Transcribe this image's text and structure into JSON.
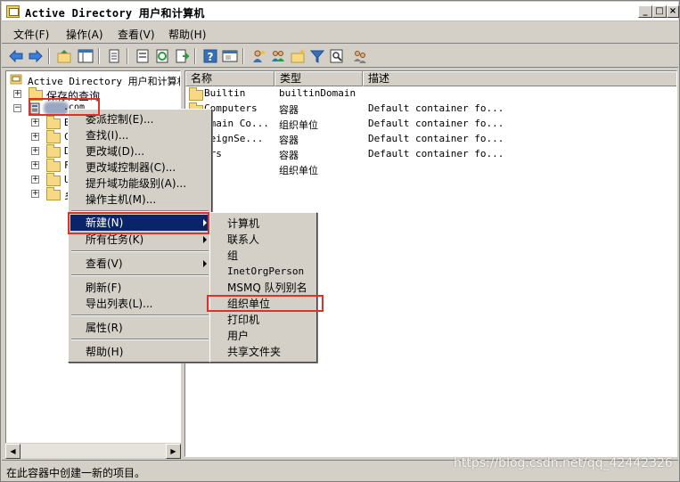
{
  "window": {
    "title": "Active Directory 用户和计算机"
  },
  "menubar": [
    {
      "label": "文件(F)"
    },
    {
      "label": "操作(A)"
    },
    {
      "label": "查看(V)"
    },
    {
      "label": "帮助(H)"
    }
  ],
  "tree": {
    "root": "Active Directory 用户和计算机",
    "saved_queries": "保存的查询",
    "domain_label": ".com",
    "children": [
      "B",
      "C",
      "D",
      "F",
      "U",
      "乡"
    ]
  },
  "list": {
    "columns": [
      "名称",
      "类型",
      "描述"
    ],
    "rows": [
      {
        "name": "Builtin",
        "type": "builtinDomain",
        "desc": ""
      },
      {
        "name": "Computers",
        "type": "容器",
        "desc": "Default container fo..."
      },
      {
        "name": "omain Co...",
        "type": "组织单位",
        "desc": "Default container fo..."
      },
      {
        "name": "reignSe...",
        "type": "容器",
        "desc": "Default container fo..."
      },
      {
        "name": "ers",
        "type": "容器",
        "desc": "Default container fo..."
      },
      {
        "name": "司",
        "type": "组织单位",
        "desc": ""
      }
    ]
  },
  "context_menu": {
    "items": [
      "委派控制(E)...",
      "查找(I)...",
      "更改域(D)...",
      "更改域控制器(C)...",
      "提升域功能级别(A)...",
      "操作主机(M)...",
      "新建(N)",
      "所有任务(K)",
      "查看(V)",
      "刷新(F)",
      "导出列表(L)...",
      "属性(R)",
      "帮助(H)"
    ]
  },
  "submenu": {
    "items": [
      "计算机",
      "联系人",
      "组",
      "InetOrgPerson",
      "MSMQ 队列别名",
      "组织单位",
      "打印机",
      "用户",
      "共享文件夹"
    ]
  },
  "statusbar": {
    "text": "在此容器中创建一新的项目。"
  },
  "watermark": "https://blog.csdn.net/qq_42442326",
  "colors": {
    "highlight": "#0a246a",
    "annotation": "#e0302a"
  }
}
